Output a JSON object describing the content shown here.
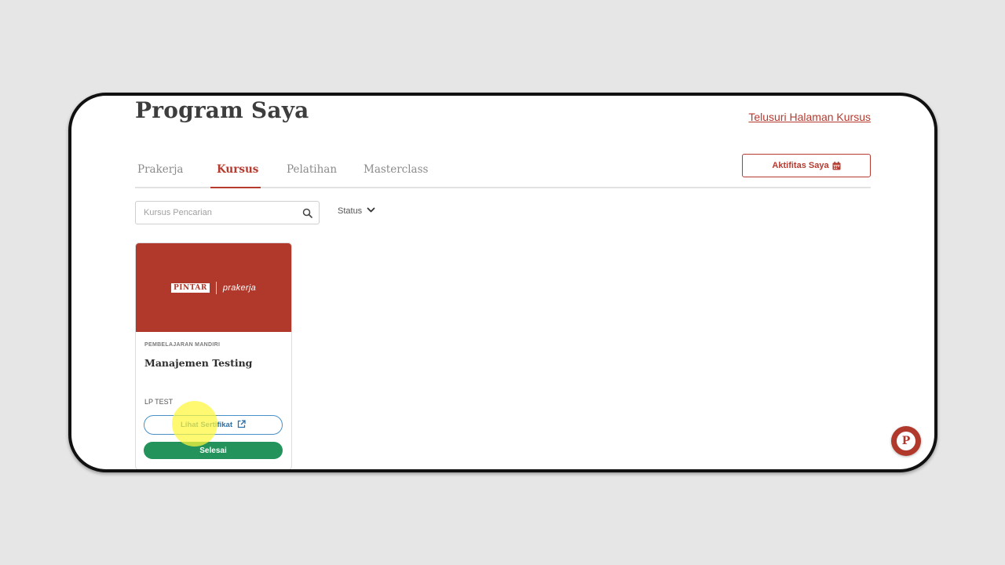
{
  "header": {
    "title": "Program Saya",
    "browse_link": "Telusuri Halaman Kursus"
  },
  "tabs": [
    {
      "label": "Prakerja",
      "active": false
    },
    {
      "label": "Kursus",
      "active": true
    },
    {
      "label": "Pelatihan",
      "active": false
    },
    {
      "label": "Masterclass",
      "active": false
    }
  ],
  "activity_button": {
    "label": "Aktifitas Saya",
    "icon": "calendar-icon"
  },
  "search": {
    "placeholder": "Kursus Pencarian",
    "value": "",
    "icon": "search-icon"
  },
  "status_filter": {
    "label": "Status",
    "icon": "chevron-down-icon"
  },
  "courses": [
    {
      "banner_logo_left": "PINTAR",
      "banner_logo_right": "prakerja",
      "category": "PEMBELAJARAN MANDIRI",
      "title": "Manajemen Testing",
      "provider": "LP TEST",
      "certificate_button": "Lihat Sertifikat",
      "status_button": "Selesai"
    }
  ],
  "chat": {
    "label": "P",
    "icon": "chat-icon"
  },
  "colors": {
    "brand": "#b0392c",
    "accent_link": "#b73a2f",
    "success": "#23935b",
    "info": "#2a6fa8",
    "highlight": "#fff63c"
  }
}
